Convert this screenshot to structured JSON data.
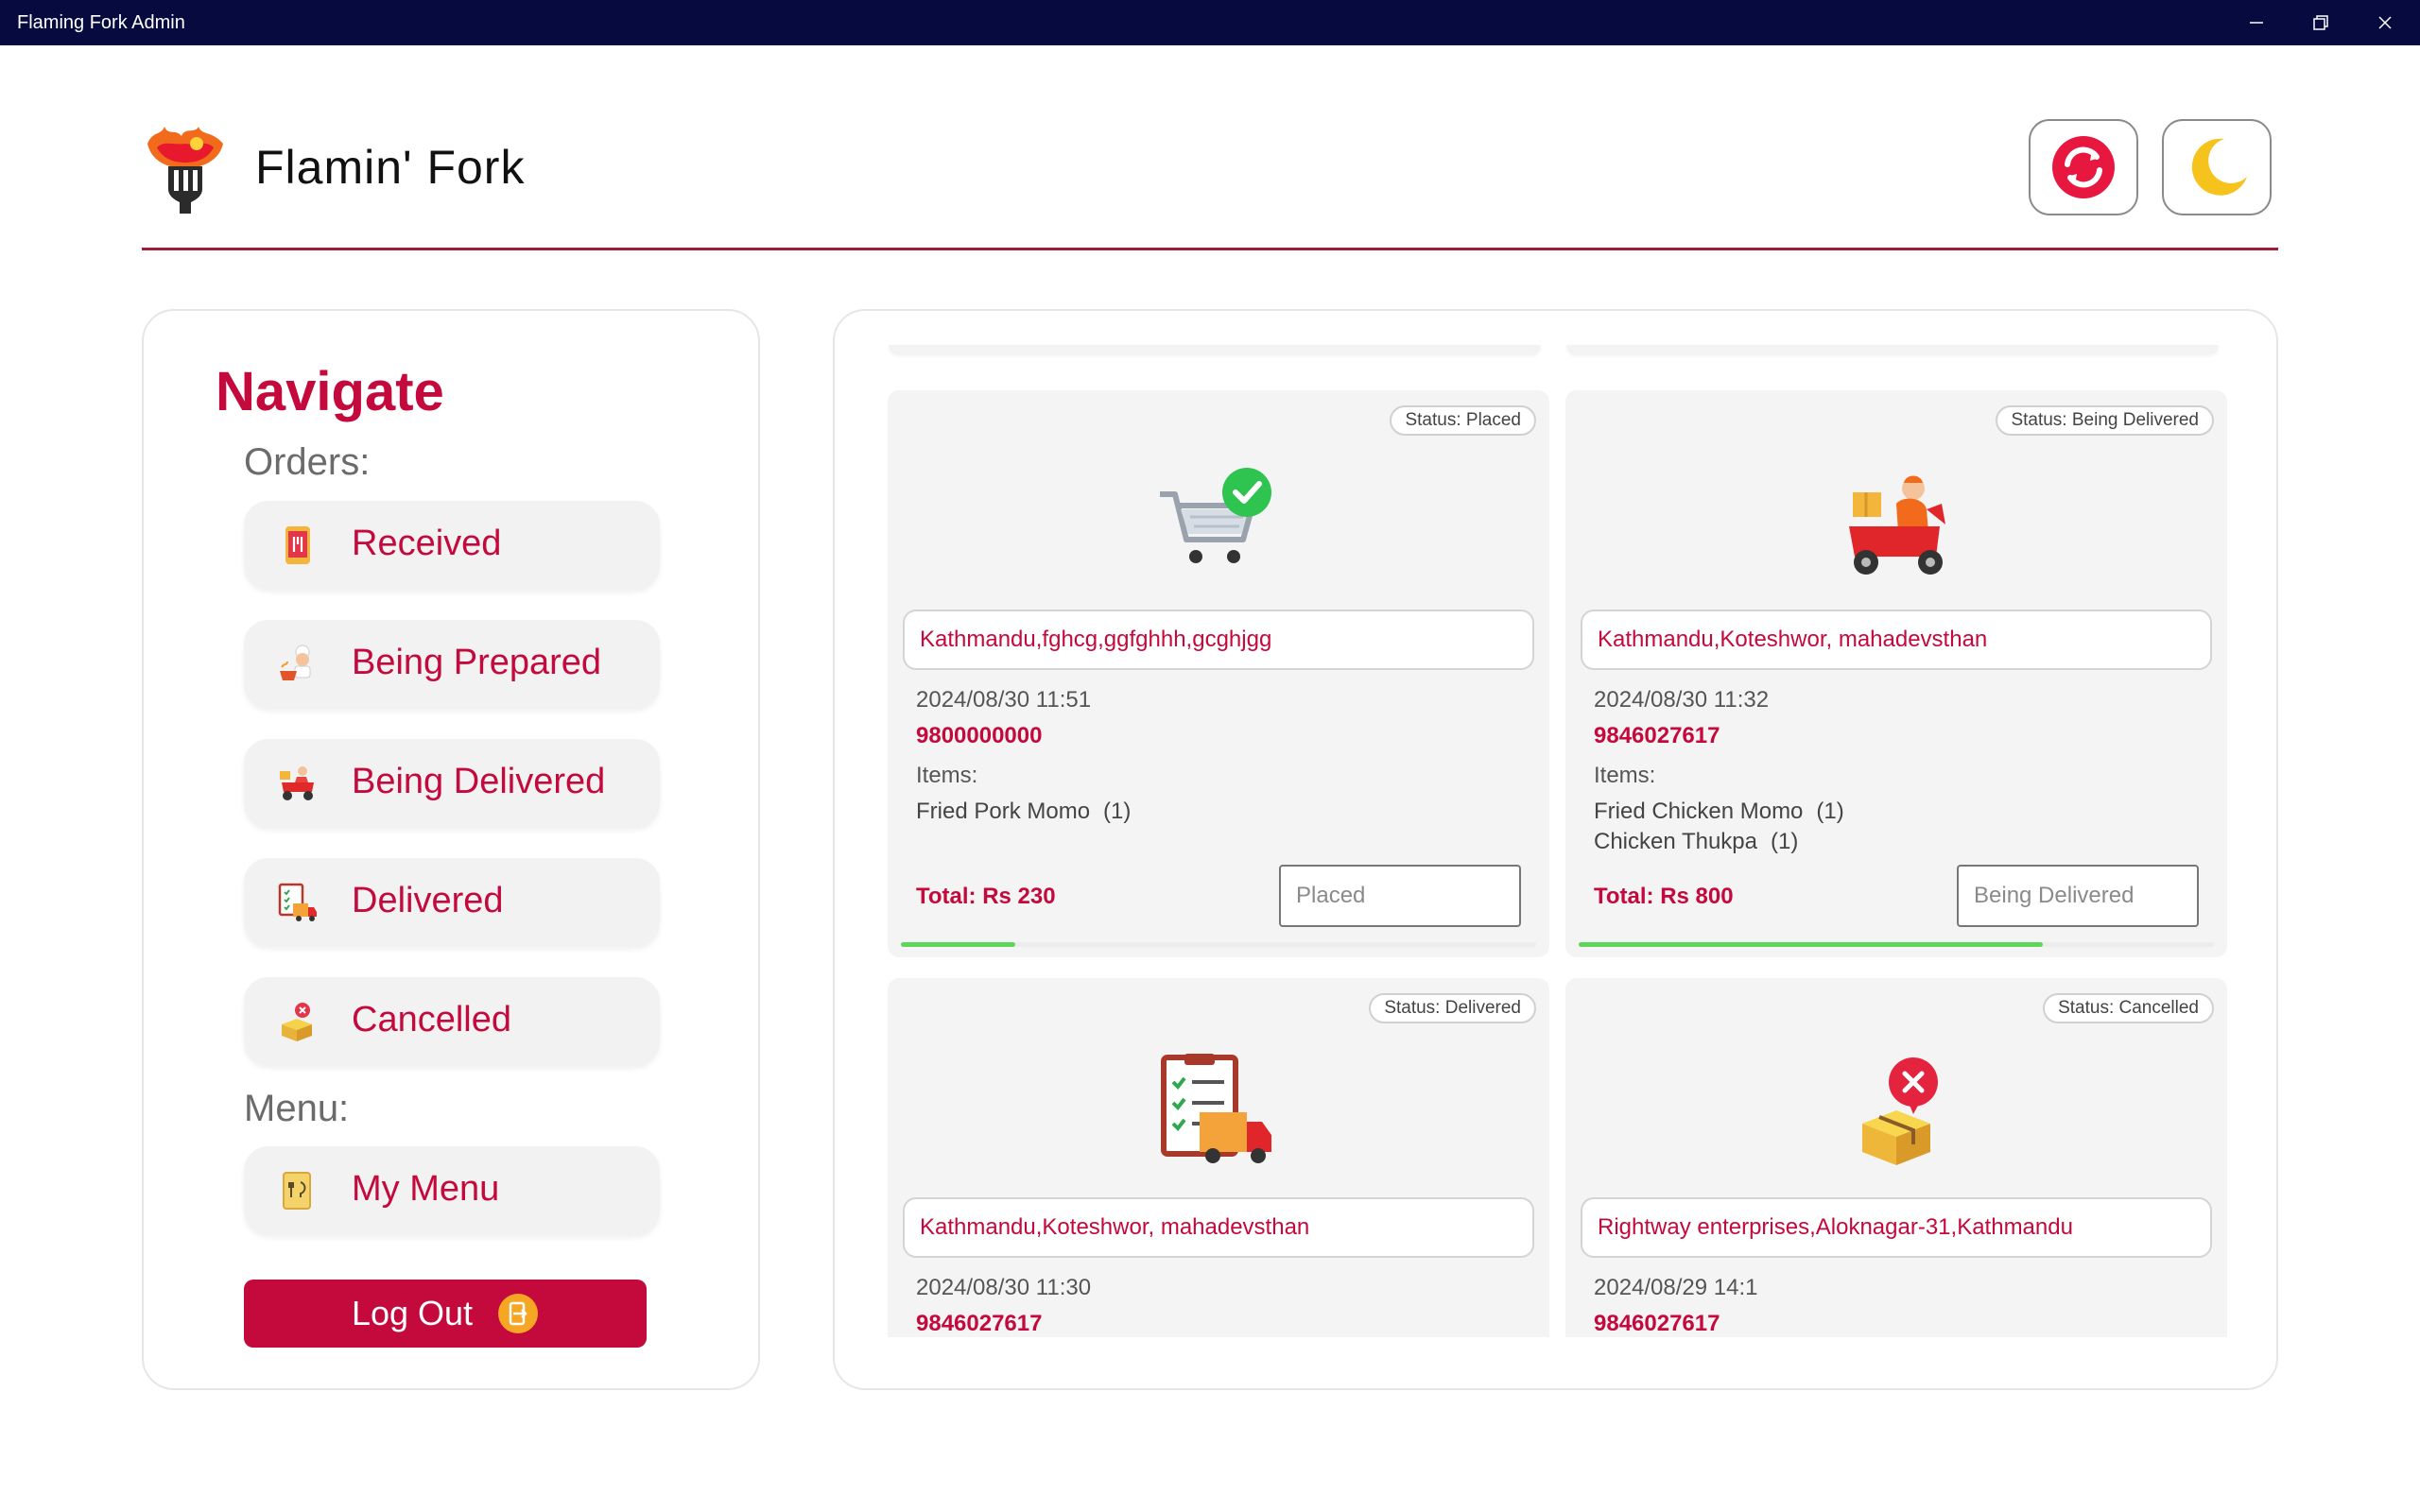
{
  "window": {
    "title": "Flaming Fork Admin"
  },
  "header": {
    "brand": "Flamin' Fork"
  },
  "sidebar": {
    "title": "Navigate",
    "orders_label": "Orders:",
    "order_items": [
      {
        "label": "Received",
        "icon": "phone-order-icon"
      },
      {
        "label": "Being Prepared",
        "icon": "chef-icon"
      },
      {
        "label": "Being Delivered",
        "icon": "scooter-icon"
      },
      {
        "label": "Delivered",
        "icon": "delivered-clipboard-icon"
      },
      {
        "label": "Cancelled",
        "icon": "cancelled-box-icon"
      }
    ],
    "menu_label": "Menu:",
    "menu_items": [
      {
        "label": "My Menu",
        "icon": "menu-card-icon"
      }
    ],
    "logout_label": "Log Out"
  },
  "orders": [
    {
      "status_badge": "Status: Placed",
      "address": "Kathmandu,fghcg,ggfghhh,gcghjgg",
      "date": "2024/08/30 11:51",
      "phone": "9800000000",
      "items_label": "Items:",
      "items": [
        {
          "name": "Fried Pork Momo",
          "qty": "(1)"
        }
      ],
      "total": "Total: Rs 230",
      "status_value": "Placed",
      "progress": 0.18
    },
    {
      "status_badge": "Status: Being Delivered",
      "address": "Kathmandu,Koteshwor, mahadevsthan",
      "date": "2024/08/30 11:32",
      "phone": "9846027617",
      "items_label": "Items:",
      "items": [
        {
          "name": "Fried Chicken Momo",
          "qty": "(1)"
        },
        {
          "name": "Chicken Thukpa",
          "qty": "(1)"
        }
      ],
      "total": "Total: Rs 800",
      "status_value": "Being Delivered",
      "progress": 0.73
    },
    {
      "status_badge": "Status: Delivered",
      "address": "Kathmandu,Koteshwor, mahadevsthan",
      "date": "2024/08/30 11:30",
      "phone": "9846027617"
    },
    {
      "status_badge": "Status: Cancelled",
      "address": "Rightway enterprises,Aloknagar-31,Kathmandu",
      "date": "2024/08/29 14:1",
      "phone": "9846027617"
    }
  ],
  "colors": {
    "accent": "#c4093c",
    "titlebar": "#060a3e",
    "progress": "#5fd65b",
    "divider": "#a01d3a"
  }
}
